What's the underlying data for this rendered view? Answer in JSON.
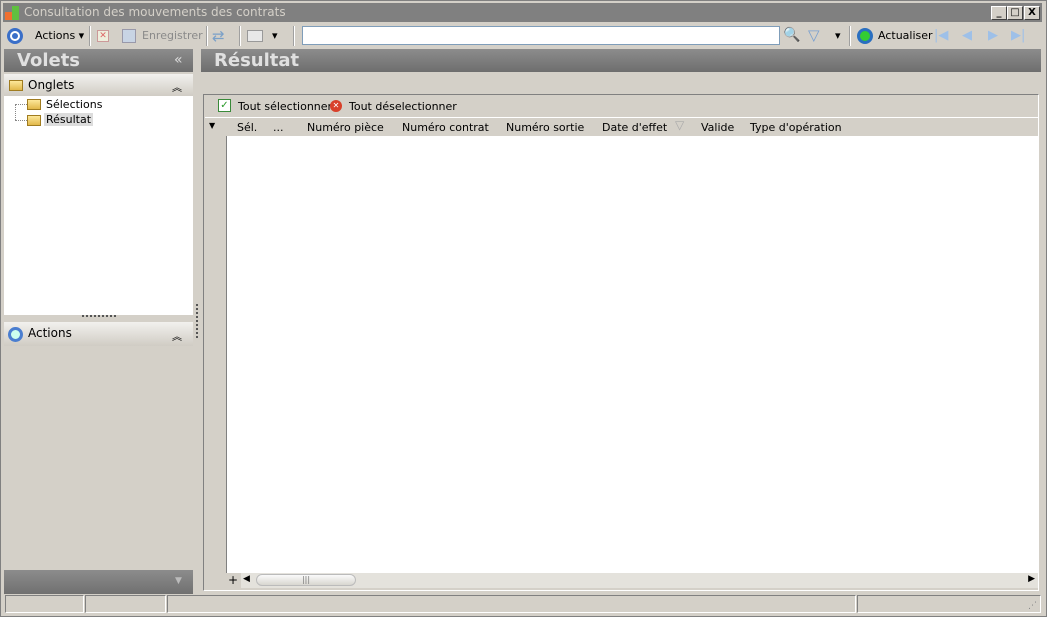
{
  "window": {
    "title": "Consultation des mouvements des contrats",
    "min": "_",
    "max": "□",
    "close": "X"
  },
  "toolbar": {
    "actions": "Actions",
    "save": "Enregistrer",
    "search_value": "",
    "refresh": "Actualiser"
  },
  "left": {
    "title": "Volets",
    "collapse": "«",
    "tabs_header": "Onglets",
    "tree": [
      "Sélections",
      "Résultat"
    ],
    "actions_header": "Actions",
    "expand": "»"
  },
  "main": {
    "title": "Résultat",
    "select_all": "Tout sélectionner",
    "deselect_all": "Tout déselectionner",
    "columns": [
      "Sél.",
      "...",
      "Numéro pièce",
      "Numéro contrat",
      "Numéro sortie",
      "Date d'effet",
      "Valide",
      "Type d'opération"
    ],
    "rows": []
  }
}
